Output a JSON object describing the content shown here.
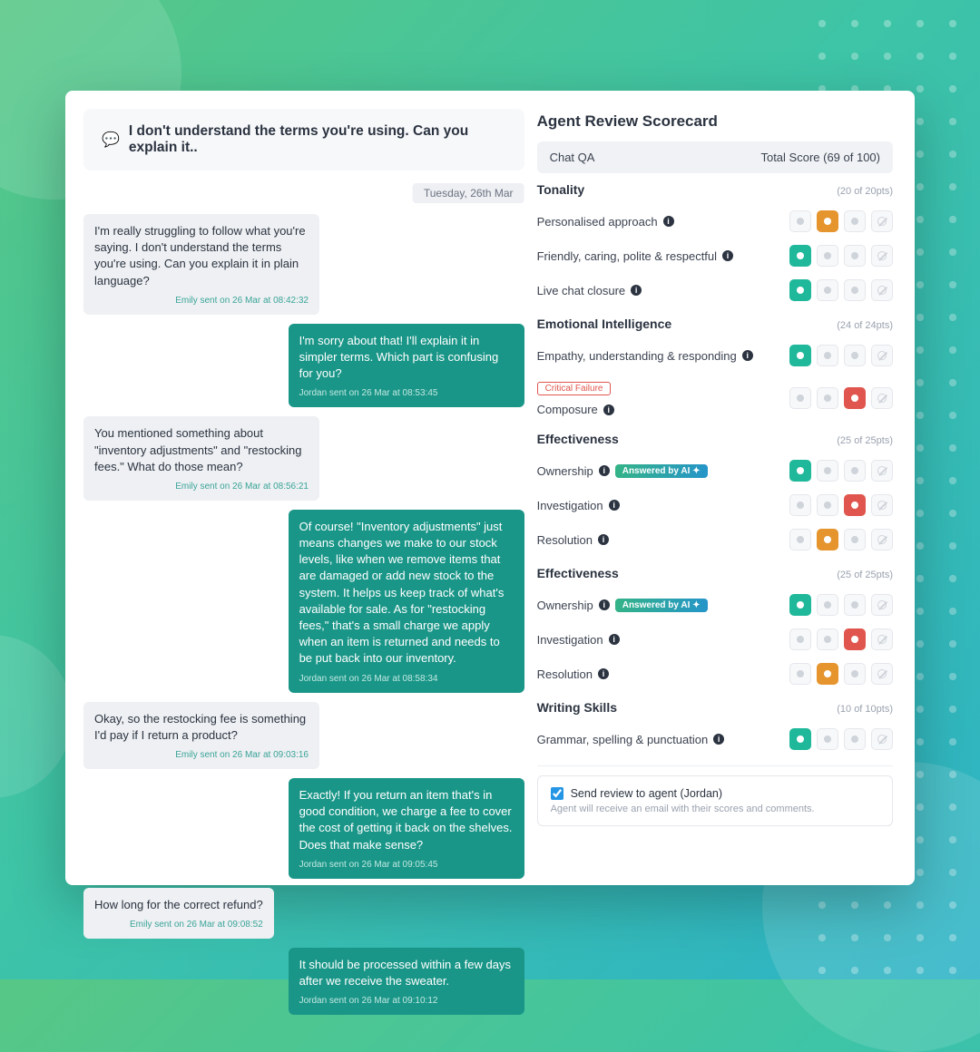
{
  "chat": {
    "title": "I don't understand the terms you're using. Can you explain it..",
    "date": "Tuesday, 26th Mar",
    "messages": [
      {
        "role": "cust",
        "body": "I'm really struggling to follow what you're saying. I don't understand the terms you're using. Can you explain it in plain language?",
        "meta": "Emily sent on 26 Mar at 08:42:32"
      },
      {
        "role": "agent",
        "body": "I'm sorry about that! I'll explain it in simpler terms. Which part is confusing for you?",
        "meta": "Jordan sent on 26 Mar at 08:53:45"
      },
      {
        "role": "cust",
        "body": "You mentioned something about \"inventory adjustments\" and \"restocking fees.\" What do those mean?",
        "meta": "Emily sent on 26 Mar at 08:56:21"
      },
      {
        "role": "agent",
        "body": "Of course! \"Inventory adjustments\" just means changes we make to our stock levels, like when we remove items that are damaged or add new stock to the system. It helps us keep track of what's available for sale. As for \"restocking fees,\" that's a small charge we apply when an item is returned and needs to be put back into our inventory.",
        "meta": "Jordan sent on 26 Mar at 08:58:34"
      },
      {
        "role": "cust",
        "body": "Okay, so the restocking fee is something I'd pay if I return a product?",
        "meta": "Emily sent on 26 Mar at 09:03:16"
      },
      {
        "role": "agent",
        "body": "Exactly! If you return an item that's in good condition, we charge a fee to cover the cost of getting it back on the shelves. Does that make sense?",
        "meta": "Jordan sent on 26 Mar at 09:05:45"
      },
      {
        "role": "cust",
        "body": "How long for the correct refund?",
        "meta": "Emily sent on 26 Mar at 09:08:52"
      },
      {
        "role": "agent",
        "body": "It should be processed within a few days after we receive the sweater.",
        "meta": "Jordan sent on 26 Mar at 09:10:12"
      }
    ]
  },
  "scorecard": {
    "title": "Agent Review Scorecard",
    "qa_label": "Chat QA",
    "total_label": "Total Score (69 of 100)",
    "sections": [
      {
        "name": "Tonality",
        "pts": "(20 of 20pts)",
        "criteria": [
          {
            "label": "Personalised approach",
            "ai": false,
            "fail": false,
            "sel": 1
          },
          {
            "label": "Friendly, caring, polite & respectful",
            "ai": false,
            "fail": false,
            "sel": 0
          },
          {
            "label": "Live chat closure",
            "ai": false,
            "fail": false,
            "sel": 0
          }
        ]
      },
      {
        "name": "Emotional Intelligence",
        "pts": "(24 of 24pts)",
        "criteria": [
          {
            "label": "Empathy, understanding & responding",
            "ai": false,
            "fail": false,
            "sel": 0
          },
          {
            "label": "Composure",
            "ai": false,
            "fail": true,
            "sel": 2
          }
        ]
      },
      {
        "name": "Effectiveness",
        "pts": "(25 of 25pts)",
        "criteria": [
          {
            "label": "Ownership",
            "ai": true,
            "fail": false,
            "sel": 0
          },
          {
            "label": "Investigation",
            "ai": false,
            "fail": false,
            "sel": 2
          },
          {
            "label": "Resolution",
            "ai": false,
            "fail": false,
            "sel": 1
          }
        ]
      },
      {
        "name": "Effectiveness",
        "pts": "(25 of 25pts)",
        "criteria": [
          {
            "label": "Ownership",
            "ai": true,
            "fail": false,
            "sel": 0
          },
          {
            "label": "Investigation",
            "ai": false,
            "fail": false,
            "sel": 2
          },
          {
            "label": "Resolution",
            "ai": false,
            "fail": false,
            "sel": 1
          }
        ]
      },
      {
        "name": "Writing Skills",
        "pts": "(10 of 10pts)",
        "criteria": [
          {
            "label": "Grammar, spelling & punctuation",
            "ai": false,
            "fail": false,
            "sel": 0
          }
        ]
      }
    ],
    "send_label": "Send review to agent (Jordan)",
    "send_hint": "Agent will receive an email with their scores and comments.",
    "ai_text": "Answered by AI",
    "fail_text": "Critical Failure"
  }
}
